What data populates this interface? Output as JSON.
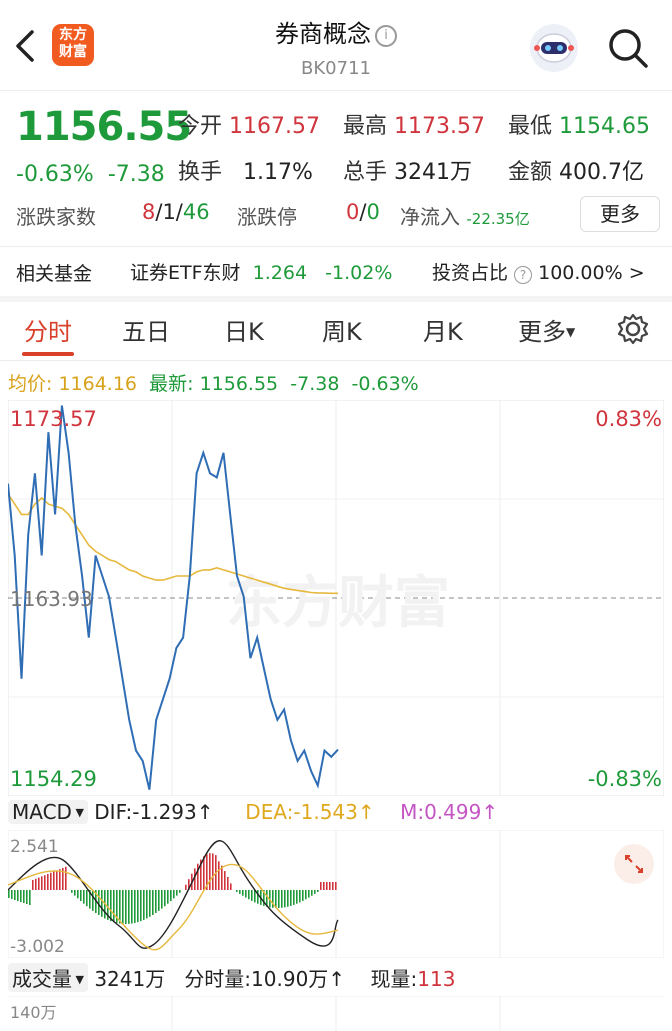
{
  "header": {
    "title": "券商概念",
    "code": "BK0711",
    "logo_text_top": "东方",
    "logo_text_bottom": "财富"
  },
  "quote": {
    "price": "1156.55",
    "change_pct": "-0.63%",
    "change_abs": "-7.38",
    "open_label": "今开",
    "open": "1167.57",
    "high_label": "最高",
    "high": "1173.57",
    "low_label": "最低",
    "low": "1154.65",
    "turnover_label": "换手",
    "turnover": "1.17%",
    "volume_label": "总手",
    "volume": "3241万",
    "amount_label": "金额",
    "amount": "400.7亿",
    "updown_label": "涨跌家数",
    "updown": "8/1/46",
    "limit_label": "涨跌停",
    "limit": "0/0",
    "netflow_label": "净流入",
    "netflow": "-22.35亿",
    "more_button": "更多"
  },
  "fund": {
    "label": "相关基金",
    "name": "证券ETF东财",
    "price": "1.264",
    "change": "-1.02%",
    "ratio_label": "投资占比",
    "ratio": "100.00%",
    "arrow": ">"
  },
  "tabs": [
    "分时",
    "五日",
    "日K",
    "周K",
    "月K",
    "更多"
  ],
  "chart_header": {
    "avg_label": "均价:",
    "avg": "1164.16",
    "latest_label": "最新:",
    "latest": "1156.55",
    "latest_chg": "-7.38",
    "latest_pct": "-0.63%"
  },
  "chart_labels": {
    "high": "1173.57",
    "mid": "1163.93",
    "low": "1154.29",
    "high_pct": "0.83%",
    "low_pct": "-0.83%",
    "watermark": "东方财富"
  },
  "macd": {
    "label": "MACD",
    "dif": "DIF:-1.293↑",
    "dea": "DEA:-1.543↑",
    "m": "M:0.499↑",
    "top": "2.541",
    "bottom": "-3.002"
  },
  "volume": {
    "label": "成交量",
    "total": "3241万",
    "minute": "分时量:10.90万↑",
    "now_label": "现量:",
    "now": "113",
    "axis_top": "140万"
  },
  "colors": {
    "up": "#d0343c",
    "down": "#1f9a3a",
    "accent": "#d9402a",
    "price_line": "#2f6db5",
    "avg_line": "#e6b83c"
  },
  "chart_data": {
    "type": "line",
    "title": "",
    "ylim": [
      1154.29,
      1173.57
    ],
    "prev_close": 1163.93,
    "series": [
      {
        "values": [
          1169.5,
          1166,
          1160,
          1167,
          1170,
          1166,
          1172,
          1168,
          1173.3,
          1171,
          1167.5,
          1165,
          1162,
          1166,
          1165,
          1164,
          1162,
          1160,
          1158,
          1156.5,
          1156,
          1154.6,
          1158,
          1159,
          1160,
          1161.5,
          1162,
          1165,
          1170,
          1171,
          1170,
          1169.8,
          1171,
          1168,
          1165,
          1164,
          1161,
          1162,
          1160.5,
          1159,
          1158,
          1158.5,
          1157,
          1156,
          1156.5,
          1155.5,
          1154.8,
          1156.5,
          1156.2,
          1156.55
        ]
      },
      {
        "values": [
          1169,
          1168.5,
          1168,
          1168,
          1168.5,
          1168.8,
          1168.5,
          1168.4,
          1168.3,
          1168,
          1167.5,
          1167,
          1166.5,
          1166.2,
          1166,
          1165.8,
          1165.7,
          1165.5,
          1165.3,
          1165.2,
          1165,
          1164.9,
          1164.8,
          1164.8,
          1164.9,
          1165,
          1165,
          1165,
          1165.2,
          1165.3,
          1165.3,
          1165.4,
          1165.3,
          1165.2,
          1165.1,
          1165,
          1164.9,
          1164.8,
          1164.7,
          1164.6,
          1164.5,
          1164.4,
          1164.35,
          1164.3,
          1164.25,
          1164.2,
          1164.18,
          1164.17,
          1164.16,
          1164.16
        ]
      }
    ]
  }
}
